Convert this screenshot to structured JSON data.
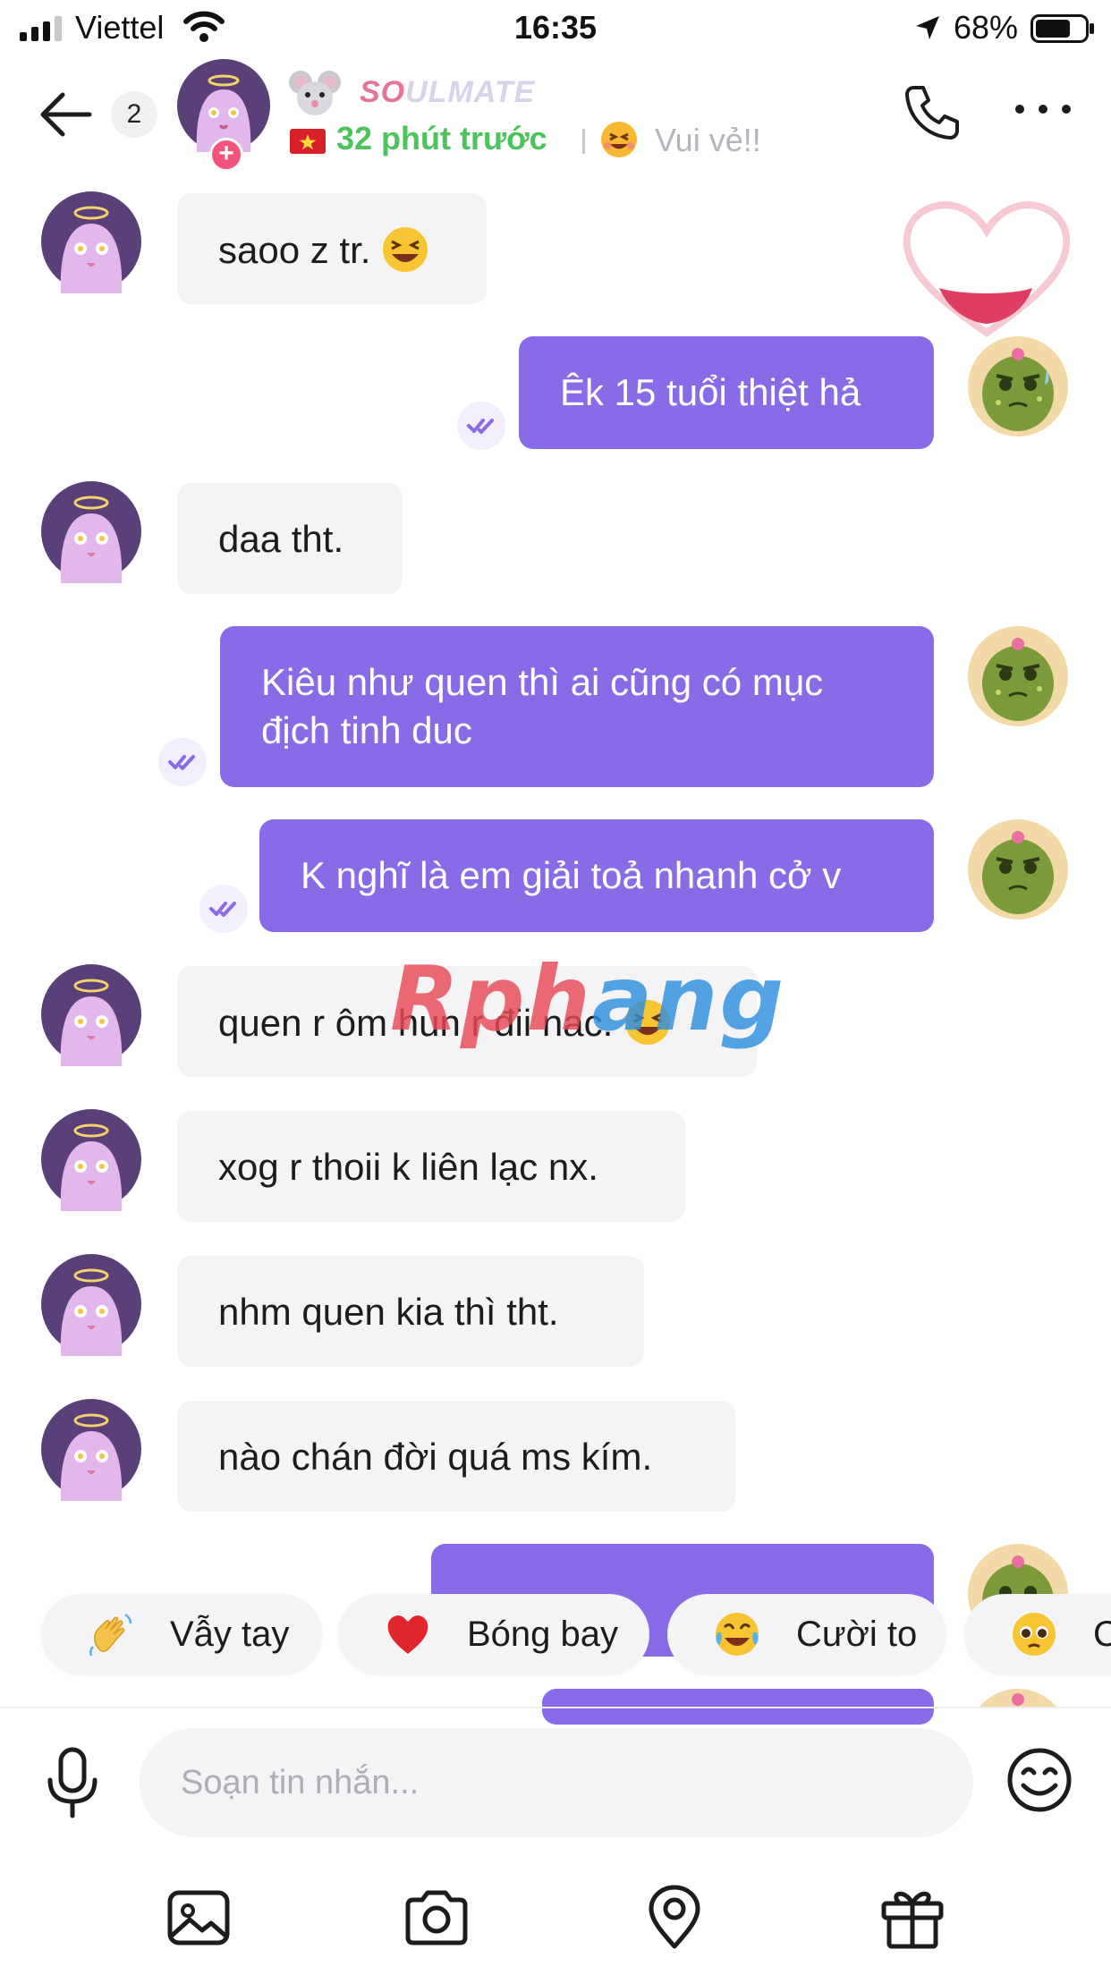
{
  "status_bar": {
    "carrier": "Viettel",
    "time": "16:35",
    "battery": "68%"
  },
  "header": {
    "unread_count": "2",
    "name_pink": "SO",
    "name_rest": "ULMATE",
    "last_seen": "32 phút trước",
    "mood": "Vui vẻ!!"
  },
  "messages": [
    {
      "dir": "in",
      "text": "saoo z tr.",
      "emoji": true
    },
    {
      "dir": "out",
      "text": "Êk 15 tuổi thiệt hả"
    },
    {
      "dir": "in",
      "text": "daa tht."
    },
    {
      "dir": "out",
      "text": "Kiêu như quen thì ai cũng có mục\nđịch tinh duc"
    },
    {
      "dir": "out",
      "text": "K nghĩ là em giải toả nhanh cở v"
    },
    {
      "dir": "in",
      "text": "quen r ôm hun r đii nac.",
      "emoji": true
    },
    {
      "dir": "in",
      "text": "xog r thoii k liên lạc nx."
    },
    {
      "dir": "in",
      "text": "nhm quen kia thì tht."
    },
    {
      "dir": "in",
      "text": "nào chán đời quá ms kím."
    }
  ],
  "watermark": {
    "part1": "Rph",
    "part2": "ang"
  },
  "quick_replies": [
    {
      "label": "Vẫy tay",
      "icon": "waving-hand-icon"
    },
    {
      "label": "Bóng bay",
      "icon": "red-heart-icon"
    },
    {
      "label": "Cười to",
      "icon": "tears-of-joy-icon"
    },
    {
      "label": "C",
      "icon": "pleading-face-icon"
    }
  ],
  "composer": {
    "placeholder": "Soạn tin nhắn..."
  },
  "toolbar": [
    "image-icon",
    "camera-icon",
    "location-icon",
    "gift-icon"
  ],
  "colors": {
    "accent": "#8a6be7",
    "incoming_bubble": "#f4f4f6",
    "online_green": "#4cc45b",
    "brand_pink": "#e8739a"
  }
}
